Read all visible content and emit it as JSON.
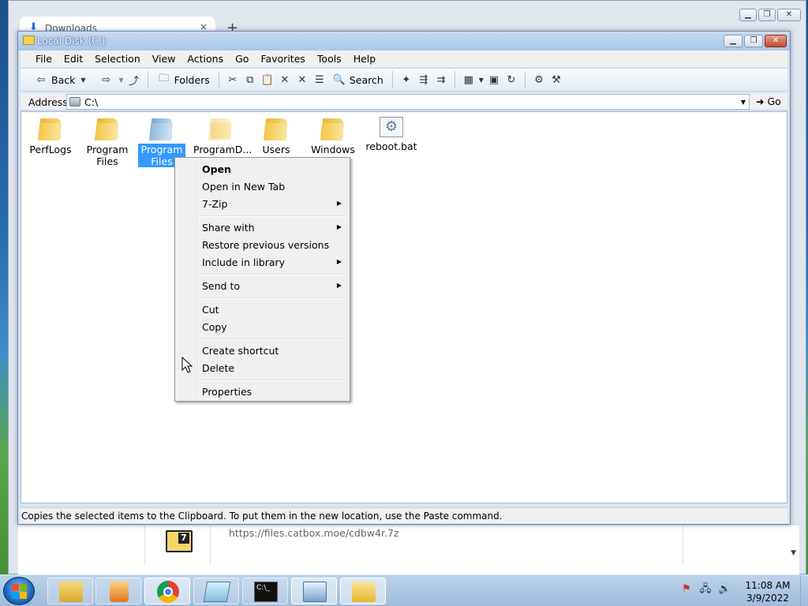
{
  "browser": {
    "tab_title": "Downloads",
    "tab_close": "×",
    "new_tab": "+",
    "download_url": "https://files.catbox.moe/cdbw4r.7z",
    "download_icon_glyph": "7"
  },
  "explorer": {
    "title": "Local Disk (C:)",
    "menu": [
      "File",
      "Edit",
      "Selection",
      "View",
      "Actions",
      "Go",
      "Favorites",
      "Tools",
      "Help"
    ],
    "toolbar": {
      "back": "Back",
      "folders": "Folders",
      "search": "Search"
    },
    "address": {
      "label": "Address",
      "value": "C:\\",
      "go": "Go"
    },
    "items": [
      {
        "label": "PerfLogs",
        "type": "folder"
      },
      {
        "label": "Program Files",
        "type": "folder"
      },
      {
        "label": "Program Files (x86)",
        "type": "folder",
        "selected": true
      },
      {
        "label": "ProgramD...",
        "type": "folder",
        "hidden": true
      },
      {
        "label": "Users",
        "type": "folder"
      },
      {
        "label": "Windows",
        "type": "folder"
      },
      {
        "label": "reboot.bat",
        "type": "bat"
      }
    ],
    "status": "Copies the selected items to the Clipboard. To put them in the new location, use the Paste command."
  },
  "context_menu": {
    "open": "Open",
    "open_new_tab": "Open in New Tab",
    "seven_zip": "7-Zip",
    "share_with": "Share with",
    "restore": "Restore previous versions",
    "include_library": "Include in library",
    "send_to": "Send to",
    "cut": "Cut",
    "copy": "Copy",
    "create_shortcut": "Create shortcut",
    "delete": "Delete",
    "properties": "Properties"
  },
  "taskbar": {
    "time": "11:08 AM",
    "date": "3/9/2022"
  },
  "colors": {
    "selection": "#3399ff",
    "menu_bg": "#f0f0f0",
    "taskbar": "#9fbbd9"
  }
}
